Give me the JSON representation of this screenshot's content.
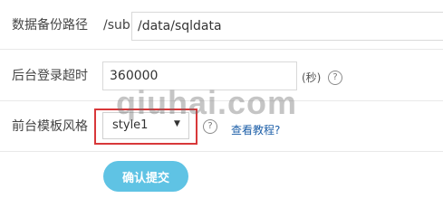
{
  "form": {
    "backup_path": {
      "label": "数据备份路径",
      "prefix": "/sub",
      "value": "/data/sqldata"
    },
    "login_timeout": {
      "label": "后台登录超时",
      "value": "360000",
      "unit": "(秒)",
      "help_icon": "question-circle-icon"
    },
    "template_style": {
      "label": "前台模板风格",
      "selected": "style1",
      "help_icon": "question-circle-icon",
      "tutorial_link": "查看教程?"
    },
    "submit_label": "确认提交"
  },
  "watermark": "qiuhai.com",
  "colors": {
    "button": "#5fc3e4",
    "highlight_border": "#d8383a",
    "link": "#1d5fa8"
  }
}
